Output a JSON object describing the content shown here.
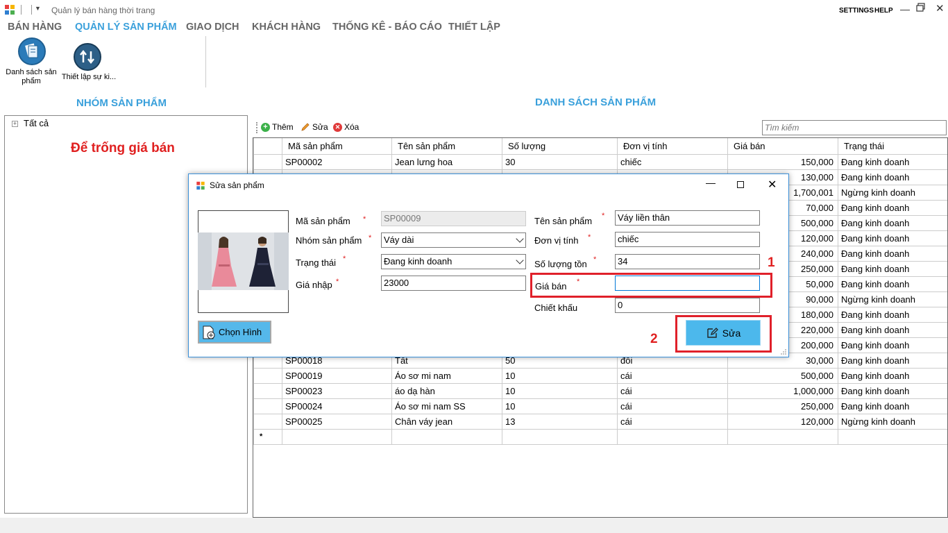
{
  "app": {
    "title": "Quản lý bán hàng thời trang",
    "settings_label": "SETTINGS",
    "help_label": "HELP"
  },
  "menu": {
    "items": [
      "BÁN HÀNG",
      "QUẢN LÝ SẢN PHẨM",
      "GIAO DỊCH",
      "KHÁCH HÀNG",
      "THỐNG KÊ - BÁO CÁO",
      "THIẾT LẬP"
    ],
    "active_index": 1
  },
  "ribbon": {
    "product_list_label": "Danh sách sản phẩm",
    "event_setup_label": "Thiết lập sự ki..."
  },
  "left_panel": {
    "heading": "NHÓM SẢN PHẨM",
    "tree_root": "Tất cả",
    "note": "Để trống giá bán"
  },
  "main": {
    "heading": "DANH SÁCH SẢN PHẨM",
    "toolbar": {
      "add_label": "Thêm",
      "edit_label": "Sửa",
      "delete_label": "Xóa",
      "search_placeholder": "Tìm kiếm"
    },
    "columns": [
      "Mã sản phẩm",
      "Tên sản phẩm",
      "Số lượng",
      "Đơn vị tính",
      "Giá bán",
      "Trạng thái"
    ],
    "rows": [
      {
        "code": "SP00002",
        "name": "Jean lưng hoa",
        "qty": "30",
        "unit": "chiếc",
        "price": "150,000",
        "status": "Đang kinh doanh"
      },
      {
        "code": "",
        "name": "",
        "qty": "",
        "unit": "",
        "price": "130,000",
        "status": "Đang kinh doanh"
      },
      {
        "code": "",
        "name": "",
        "qty": "",
        "unit": "",
        "price": "1,700,001",
        "status": "Ngừng kinh doanh"
      },
      {
        "code": "",
        "name": "",
        "qty": "",
        "unit": "",
        "price": "70,000",
        "status": "Đang kinh doanh"
      },
      {
        "code": "",
        "name": "",
        "qty": "",
        "unit": "",
        "price": "500,000",
        "status": "Đang kinh doanh"
      },
      {
        "code": "",
        "name": "",
        "qty": "",
        "unit": "",
        "price": "120,000",
        "status": "Đang kinh doanh"
      },
      {
        "code": "",
        "name": "",
        "qty": "",
        "unit": "",
        "price": "240,000",
        "status": "Đang kinh doanh"
      },
      {
        "code": "",
        "name": "",
        "qty": "",
        "unit": "",
        "price": "250,000",
        "status": "Đang kinh doanh"
      },
      {
        "code": "",
        "name": "",
        "qty": "",
        "unit": "",
        "price": "50,000",
        "status": "Đang kinh doanh"
      },
      {
        "code": "",
        "name": "",
        "qty": "",
        "unit": "",
        "price": "90,000",
        "status": "Ngừng kinh doanh"
      },
      {
        "code": "",
        "name": "",
        "qty": "",
        "unit": "",
        "price": "180,000",
        "status": "Đang kinh doanh"
      },
      {
        "code": "",
        "name": "",
        "qty": "",
        "unit": "",
        "price": "220,000",
        "status": "Đang kinh doanh"
      },
      {
        "code": "",
        "name": "",
        "qty": "",
        "unit": "",
        "price": "200,000",
        "status": "Đang kinh doanh"
      },
      {
        "code": "SP00018",
        "name": "Tất",
        "qty": "50",
        "unit": "đôi",
        "price": "30,000",
        "status": "Đang kinh doanh"
      },
      {
        "code": "SP00019",
        "name": "Áo sơ mi nam",
        "qty": "10",
        "unit": "cái",
        "price": "500,000",
        "status": "Đang kinh doanh"
      },
      {
        "code": "SP00023",
        "name": "áo dạ hàn",
        "qty": "10",
        "unit": "cái",
        "price": "1,000,000",
        "status": "Đang kinh doanh"
      },
      {
        "code": "SP00024",
        "name": "Áo sơ mi nam SS",
        "qty": "10",
        "unit": "cái",
        "price": "250,000",
        "status": "Đang kinh doanh"
      },
      {
        "code": "SP00025",
        "name": "Chân váy jean",
        "qty": "13",
        "unit": "cái",
        "price": "120,000",
        "status": "Ngừng kinh doanh"
      }
    ],
    "new_row_marker": "*"
  },
  "dialog": {
    "title": "Sửa sản phẩm",
    "choose_image_label": "Chọn Hình",
    "fields": {
      "code_label": "Mã sản phẩm",
      "code_value": "SP00009",
      "group_label": "Nhóm sản phẩm",
      "group_value": "Váy dài",
      "status_label": "Trạng thái",
      "status_value": "Đang kinh doanh",
      "cost_label": "Giá nhập",
      "cost_value": "23000",
      "name_label": "Tên sản phẩm",
      "name_value": "Váy liền thân",
      "unit_label": "Đơn vị tính",
      "unit_value": "chiếc",
      "stock_label": "Số lượng tồn",
      "stock_value": "34",
      "price_label": "Giá bán",
      "price_value": "",
      "discount_label": "Chiết khấu",
      "discount_value": "0"
    },
    "required_mark": "*",
    "submit_label": "Sửa"
  },
  "annotations": {
    "step1": "1",
    "step2": "2",
    "highlight_color": "#e0202a"
  },
  "colors": {
    "accent": "#3aa0db",
    "button": "#4cb8ec"
  }
}
